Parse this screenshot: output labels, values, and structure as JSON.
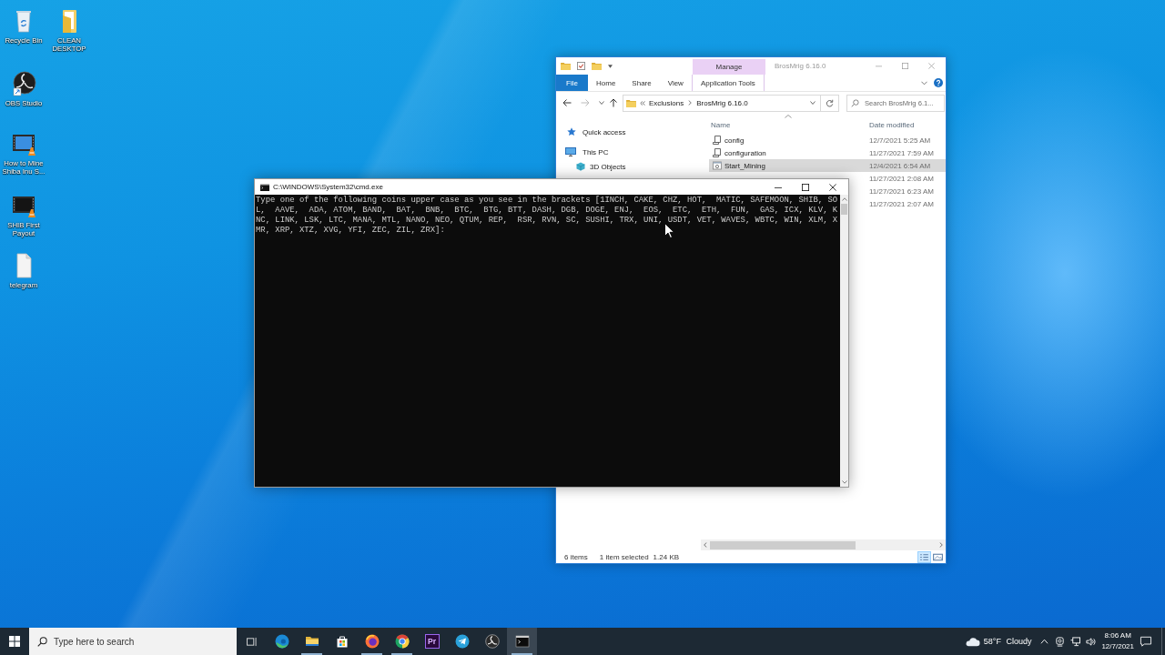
{
  "desktop_icons": [
    {
      "label": "Recycle Bin",
      "kind": "recycle_bin"
    },
    {
      "label": "CLEAN DESKTOP",
      "kind": "folder"
    },
    {
      "label": "OBS Studio",
      "kind": "app"
    },
    {
      "label": "How to Mine Shiba Inu S...",
      "kind": "video"
    },
    {
      "label": "SHIB First Payout",
      "kind": "video"
    },
    {
      "label": "telegram",
      "kind": "document"
    }
  ],
  "explorer": {
    "title": "BrosMrig 6.16.0",
    "context_group": "Manage",
    "ribbon_tabs": [
      {
        "label": "File",
        "kind": "file_menu"
      },
      {
        "label": "Home",
        "kind": "tab"
      },
      {
        "label": "Share",
        "kind": "tab"
      },
      {
        "label": "View",
        "kind": "tab"
      },
      {
        "label": "Application Tools",
        "kind": "context_tab"
      }
    ],
    "address": [
      "Exclusions",
      "BrosMrig 6.16.0"
    ],
    "search": {
      "placeholder": "Search BrosMrig 6.1..."
    },
    "nav": [
      {
        "label": "Quick access",
        "kind": "quick_access"
      },
      {
        "label": "This PC",
        "kind": "this_pc",
        "children": [
          {
            "label": "3D Objects",
            "kind": "objects_3d"
          }
        ]
      }
    ],
    "columns": [
      {
        "label": "Name",
        "sorted": true
      },
      {
        "label": "Date modified",
        "sorted": false
      }
    ],
    "files": [
      {
        "name": "config",
        "kind": "script",
        "date": "12/7/2021 5:25 AM",
        "selected": false
      },
      {
        "name": "configuration",
        "kind": "script",
        "date": "11/27/2021 7:59 AM",
        "selected": false
      },
      {
        "name": "Start_Mining",
        "kind": "batch",
        "date": "12/4/2021 6:54 AM",
        "selected": true
      },
      {
        "date": "11/27/2021 2:08 AM",
        "selected": false
      },
      {
        "date": "11/27/2021 6:23 AM",
        "selected": false
      },
      {
        "date": "11/27/2021 2:07 AM",
        "selected": false
      }
    ],
    "status_bar": {
      "item_count": "6 items",
      "selection": "1 item selected",
      "size": "1.24 KB"
    },
    "view_buttons": [
      {
        "kind": "details",
        "selected": true
      },
      {
        "kind": "large_icons",
        "selected": false
      }
    ]
  },
  "console": {
    "title": "C:\\WINDOWS\\System32\\cmd.exe",
    "lines": [
      "Type one of the following coins upper case as you see in the brackets [1INCH, CAKE, CHZ, HOT,  MATIC, SAFEMOON, SHIB, SO",
      "L,  AAVE,  ADA, ATOM, BAND,  BAT,  BNB,  BTC,  BTG, BTT, DASH, DGB, DOGE, ENJ,  EOS,  ETC,  ETH,  FUN,  GAS, ICX, KLV, K",
      "NC, LINK, LSK, LTC, MANA, MTL, NANO, NEO, QTUM, REP,  RSR, RVN, SC, SUSHI, TRX, UNI, USDT, VET, WAVES, WBTC, WIN, XLM, X",
      "MR, XRP, XTZ, XVG, YFI, ZEC, ZIL, ZRX]:"
    ]
  },
  "taskbar": {
    "search": {
      "placeholder": "Type here to search"
    },
    "apps": [
      {
        "kind": "edge",
        "running": false,
        "active": false
      },
      {
        "kind": "explorer",
        "running": true,
        "active": false
      },
      {
        "kind": "store",
        "running": false,
        "active": false
      },
      {
        "kind": "firefox",
        "running": true,
        "active": false
      },
      {
        "kind": "chrome",
        "running": true,
        "active": false
      },
      {
        "kind": "premiere",
        "label": "Pr",
        "running": false,
        "active": false
      },
      {
        "kind": "telegram",
        "running": false,
        "active": false
      },
      {
        "kind": "obs",
        "running": false,
        "active": false
      },
      {
        "kind": "cmd",
        "running": true,
        "active": true
      }
    ],
    "tray": {
      "weather": "58°F Cloudy",
      "time": "8:06 AM",
      "date": "12/7/2021"
    }
  }
}
